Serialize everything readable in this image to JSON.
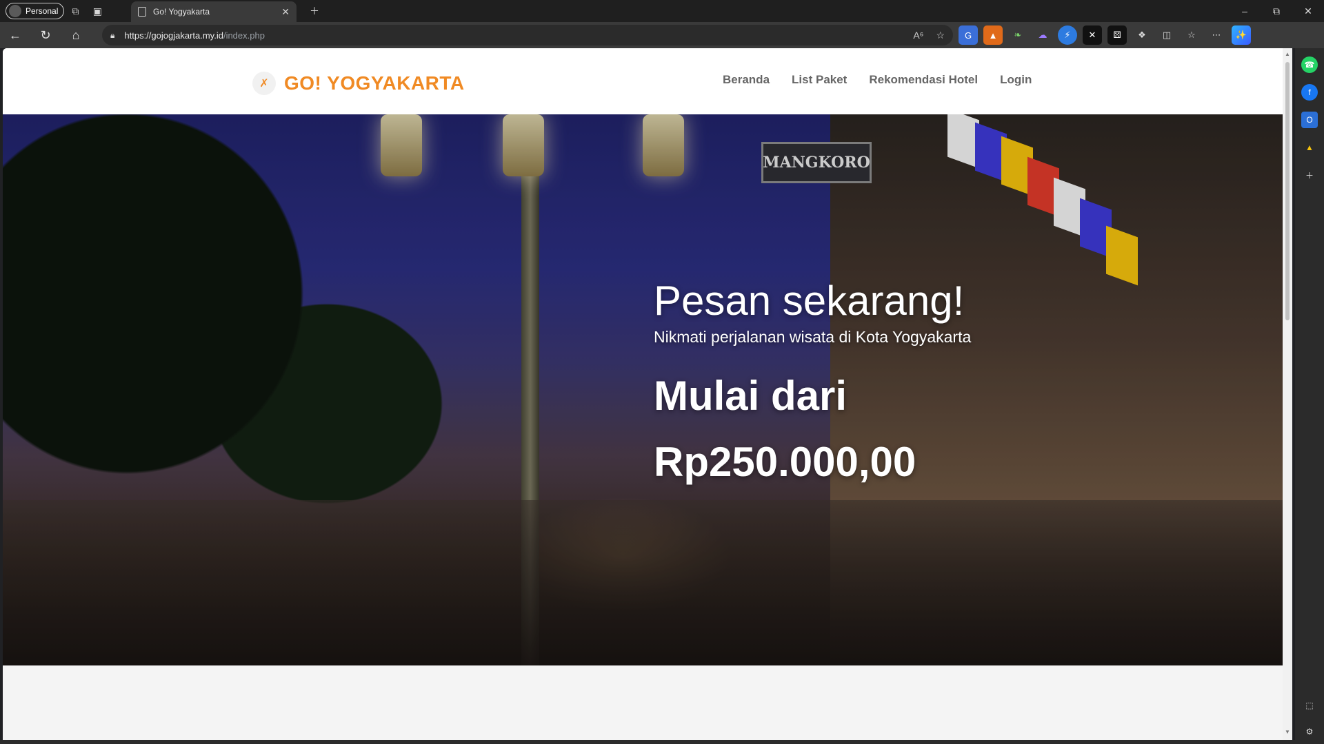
{
  "browser": {
    "profile_label": "Personal",
    "tab_title": "Go! Yogyakarta",
    "url_scheme_host": "https://gojogjakarta.my.id",
    "url_path": "/index.php"
  },
  "site": {
    "logo_text": "GO! YOGYAKARTA",
    "logo_mark": "✗",
    "menu": [
      {
        "label": "Beranda"
      },
      {
        "label": "List Paket"
      },
      {
        "label": "Rekomendasi Hotel"
      },
      {
        "label": "Login"
      }
    ],
    "accent_color": "#f08a24"
  },
  "hero": {
    "title": "Pesan sekarang!",
    "subtitle": "Nikmati perjalanan wisata di Kota Yogyakarta",
    "price_label": "Mulai dari",
    "price": "Rp250.000,00",
    "sign_text": "MANGKORO"
  }
}
